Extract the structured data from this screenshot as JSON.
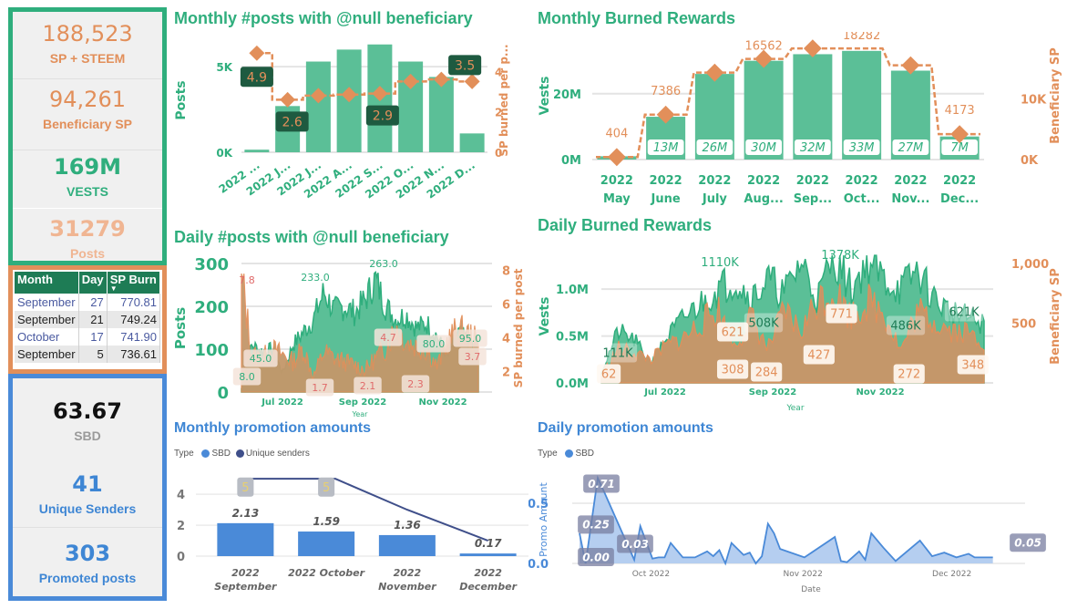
{
  "kpi_top": [
    {
      "value": "188,523",
      "label": "SP + STEEM"
    },
    {
      "value": "94,261",
      "label": "Beneficiary SP"
    },
    {
      "value": "169M",
      "label": "VESTS"
    },
    {
      "value": "31279",
      "label": "Posts"
    }
  ],
  "top_table": {
    "headers": [
      "Month",
      "Day",
      "SP Burn"
    ],
    "sort_indicator": "▼",
    "rows": [
      [
        "September",
        "27",
        "770.81"
      ],
      [
        "September",
        "21",
        "749.24"
      ],
      [
        "October",
        "17",
        "741.90"
      ],
      [
        "September",
        "5",
        "736.61"
      ]
    ]
  },
  "kpi_promo": [
    {
      "value": "63.67",
      "label": "SBD"
    },
    {
      "value": "41",
      "label": "Unique Senders"
    },
    {
      "value": "303",
      "label": "Promoted posts"
    }
  ],
  "colors": {
    "green": "#2fae7d",
    "bar_green": "#5bbf97",
    "orange": "#e28f5a",
    "brown_area": "#c4976a",
    "blue": "#4a8ad8",
    "navy": "#3f4f8a",
    "dark_label": "#1e5a40"
  },
  "chart_data": [
    {
      "id": "monthly_posts",
      "type": "bar",
      "title": "Monthly #posts with @null beneficiary",
      "ylabel": "Posts",
      "y2label": "SP burned per p...",
      "categories": [
        "2022 ...",
        "2022 J...",
        "2022 J...",
        "2022 A...",
        "2022 S...",
        "2022 O...",
        "2022 N...",
        "2022 D..."
      ],
      "yticks": [
        "0K",
        "5K"
      ],
      "ylim": [
        0,
        6500
      ],
      "y2ticks": [
        "0",
        "2",
        "4"
      ],
      "y2lim": [
        0,
        5.5
      ],
      "series": [
        {
          "name": "Posts",
          "type": "bar",
          "values": [
            150,
            2700,
            5300,
            6000,
            6300,
            5300,
            4400,
            1100
          ]
        },
        {
          "name": "SP burned per post",
          "type": "step-line",
          "values": [
            4.9,
            2.6,
            2.8,
            2.85,
            2.9,
            3.5,
            3.6,
            3.5
          ]
        }
      ],
      "data_labels": [
        {
          "index": 0,
          "text": "4.9"
        },
        {
          "index": 1,
          "text": "2.6"
        },
        {
          "index": 4,
          "text": "2.9"
        },
        {
          "index": 7,
          "text": "3.5"
        }
      ]
    },
    {
      "id": "monthly_burned",
      "type": "bar",
      "title": "Monthly Burned Rewards",
      "ylabel": "Vests",
      "y2label": "Beneficiary SP",
      "categories": [
        [
          "2022",
          "May"
        ],
        [
          "2022",
          "June"
        ],
        [
          "2022",
          "July"
        ],
        [
          "2022",
          "Aug..."
        ],
        [
          "2022",
          "Sep..."
        ],
        [
          "2022",
          "Oct..."
        ],
        [
          "2022",
          "Nov..."
        ],
        [
          "2022",
          "Dec..."
        ]
      ],
      "yticks": [
        "0M",
        "20M"
      ],
      "ylim": [
        0,
        36
      ],
      "y2ticks": [
        "0K",
        "10K"
      ],
      "y2lim": [
        0,
        19500
      ],
      "series": [
        {
          "name": "Vests (M)",
          "type": "bar",
          "values": [
            1,
            13,
            26,
            30,
            32,
            33,
            27,
            7
          ],
          "labels": [
            "",
            "13M",
            "26M",
            "30M",
            "32M",
            "33M",
            "27M",
            "7M"
          ]
        },
        {
          "name": "Beneficiary SP",
          "type": "step-line",
          "values": [
            404,
            7386,
            14300,
            16562,
            18282,
            18282,
            15500,
            4173
          ],
          "labels": [
            "404",
            "7386",
            "",
            "16562",
            "",
            "18282",
            "",
            "4173"
          ]
        }
      ]
    },
    {
      "id": "daily_posts",
      "type": "area",
      "title": "Daily #posts with @null beneficiary",
      "ylabel": "Posts",
      "y2label": "SP burned per post",
      "xlabel": "Year",
      "xticks": [
        "Jul 2022",
        "Sep 2022",
        "Nov 2022"
      ],
      "yticks": [
        "0",
        "100",
        "200",
        "300"
      ],
      "ylim": [
        0,
        300
      ],
      "y2ticks": [
        "2",
        "4",
        "6",
        "8"
      ],
      "y2lim": [
        0.8,
        8.4
      ],
      "series": [
        {
          "name": "Posts",
          "anchors": [
            8,
            110,
            95,
            100,
            45,
            110,
            140,
            170,
            233,
            190,
            200,
            185,
            215,
            263,
            200,
            170,
            180,
            150,
            160,
            130,
            80,
            140,
            120,
            95
          ]
        },
        {
          "name": "SP burned per post",
          "anchors": [
            7.8,
            3.0,
            2.8,
            3.3,
            3.0,
            2.6,
            3.4,
            1.7,
            3.2,
            2.8,
            2.6,
            2.4,
            2.1,
            2.8,
            3.4,
            4.7,
            3.8,
            3.5,
            3.3,
            2.3,
            3.8,
            4.5,
            4.2,
            3.7
          ]
        }
      ],
      "data_labels": {
        "posts": [
          {
            "pos": 0.0,
            "text": "8.0"
          },
          {
            "pos": 0.06,
            "text": "45.0"
          },
          {
            "pos": 0.3,
            "text": "233.0"
          },
          {
            "pos": 0.6,
            "text": "263.0"
          },
          {
            "pos": 0.82,
            "text": "80.0"
          },
          {
            "pos": 0.98,
            "text": "95.0"
          }
        ],
        "sp": [
          {
            "pos": 0.0,
            "text": "7.8"
          },
          {
            "pos": 0.32,
            "text": "1.7"
          },
          {
            "pos": 0.53,
            "text": "2.1"
          },
          {
            "pos": 0.62,
            "text": "4.7"
          },
          {
            "pos": 0.74,
            "text": "2.3"
          },
          {
            "pos": 0.99,
            "text": "3.7"
          }
        ]
      }
    },
    {
      "id": "daily_burned",
      "type": "area",
      "title": "Daily Burned Rewards",
      "ylabel": "Vests",
      "y2label": "Beneficiary SP",
      "xlabel": "Year",
      "xticks": [
        "Jul 2022",
        "Sep 2022",
        "Nov 2022"
      ],
      "yticks": [
        "0.0M",
        "0.5M",
        "1.0M"
      ],
      "ylim": [
        0,
        1.4
      ],
      "y2ticks": [
        "500",
        "1,000"
      ],
      "y2lim": [
        0,
        1100
      ],
      "series": [
        {
          "name": "Vests (M)",
          "anchors": [
            0.111,
            0.55,
            0.45,
            0.2,
            0.5,
            0.7,
            0.85,
            1.0,
            1.11,
            0.9,
            1.1,
            0.95,
            1.3,
            0.9,
            1.378,
            1.0,
            1.3,
            1.1,
            1.0,
            1.2,
            0.9,
            0.75,
            0.7,
            0.621
          ]
        },
        {
          "name": "Beneficiary SP",
          "anchors": [
            62,
            290,
            250,
            200,
            320,
            380,
            500,
            621,
            308,
            550,
            284,
            600,
            427,
            700,
            771,
            560,
            680,
            600,
            272,
            600,
            520,
            450,
            420,
            348
          ]
        }
      ],
      "data_labels": {
        "vests": [
          {
            "pos": 0.02,
            "text": "111K"
          },
          {
            "pos": 0.3,
            "text": "1110K"
          },
          {
            "pos": 0.42,
            "text": "508K"
          },
          {
            "pos": 0.63,
            "text": "1378K"
          },
          {
            "pos": 0.81,
            "text": "486K"
          },
          {
            "pos": 0.97,
            "text": "621K"
          }
        ],
        "sp": [
          {
            "pos": 0.01,
            "text": "62"
          },
          {
            "pos": 0.34,
            "text": "621"
          },
          {
            "pos": 0.34,
            "text": "308"
          },
          {
            "pos": 0.43,
            "text": "284"
          },
          {
            "pos": 0.57,
            "text": "427"
          },
          {
            "pos": 0.63,
            "text": "771"
          },
          {
            "pos": 0.81,
            "text": "272"
          },
          {
            "pos": 0.98,
            "text": "348"
          }
        ]
      }
    },
    {
      "id": "monthly_promo",
      "type": "bar",
      "title": "Monthly promotion amounts",
      "legend_title": "Type",
      "legend": [
        "SBD",
        "Unique senders"
      ],
      "categories": [
        [
          "2022",
          "September"
        ],
        [
          "2022 October"
        ],
        [
          "2022",
          "November"
        ],
        [
          "2022",
          "December"
        ]
      ],
      "yticks": [
        "0",
        "2",
        "4"
      ],
      "ylim": [
        0,
        5.6
      ],
      "series": [
        {
          "name": "SBD",
          "type": "bar",
          "values": [
            2.13,
            1.59,
            1.36,
            0.17
          ],
          "labels": [
            "2.13",
            "1.59",
            "1.36",
            "0.17"
          ]
        },
        {
          "name": "Unique senders",
          "type": "line",
          "values": [
            5,
            5,
            3,
            1
          ],
          "labels": [
            "5",
            "5",
            "",
            ""
          ]
        }
      ]
    },
    {
      "id": "daily_promo",
      "type": "area",
      "title": "Daily promotion amounts",
      "legend_title": "Type",
      "legend": [
        "SBD"
      ],
      "ylabel": "Promo Amount",
      "xlabel": "Date",
      "xticks": [
        "Oct 2022",
        "Nov 2022",
        "Dec 2022"
      ],
      "yticks": [
        "0.0",
        "0.5"
      ],
      "ylim": [
        0,
        0.78
      ],
      "x": [
        0,
        1,
        3,
        4,
        9,
        10,
        12,
        13,
        14,
        15,
        17,
        18,
        19,
        21,
        22,
        23,
        24,
        25,
        27,
        28,
        29,
        30,
        31,
        32,
        33,
        37,
        42,
        43,
        44,
        46,
        47,
        48,
        50,
        52,
        56,
        58,
        60,
        62,
        64,
        65,
        68
      ],
      "values": [
        0.25,
        0.0,
        0.71,
        0.6,
        0.03,
        0.31,
        0.04,
        0.05,
        0.05,
        0.17,
        0.05,
        0.05,
        0.05,
        0.1,
        0.06,
        0.11,
        0.0,
        0.17,
        0.07,
        0.09,
        0.0,
        0.06,
        0.33,
        0.25,
        0.12,
        0.05,
        0.22,
        0.02,
        0.01,
        0.1,
        0.03,
        0.25,
        0.13,
        0.02,
        0.19,
        0.06,
        0.09,
        0.05,
        0.08,
        0.05,
        0.05
      ],
      "data_labels": [
        {
          "index": 1,
          "text": "0.00"
        },
        {
          "index": 0,
          "text": "0.25"
        },
        {
          "index": 2,
          "text": "0.71"
        },
        {
          "index": 4,
          "text": "0.03"
        },
        {
          "index": 40,
          "text": "0.05"
        }
      ]
    }
  ]
}
